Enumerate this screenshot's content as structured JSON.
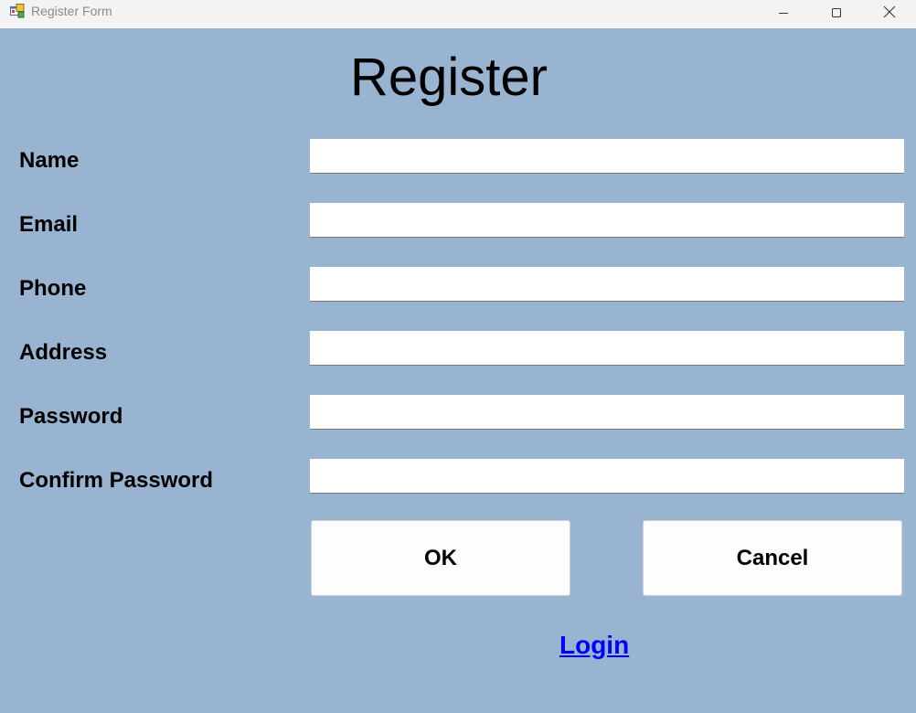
{
  "window": {
    "title": "Register Form",
    "icon": "winforms-app-icon",
    "controls": {
      "minimize_icon": "minimize-icon",
      "maximize_icon": "maximize-icon",
      "close_icon": "close-icon"
    }
  },
  "form": {
    "heading": "Register",
    "background_color": "#99b4d1",
    "fields": [
      {
        "label": "Name",
        "value": ""
      },
      {
        "label": "Email",
        "value": ""
      },
      {
        "label": "Phone",
        "value": ""
      },
      {
        "label": "Address",
        "value": ""
      },
      {
        "label": "Password",
        "value": ""
      },
      {
        "label": "Confirm Password",
        "value": ""
      }
    ],
    "buttons": {
      "ok_label": "OK",
      "cancel_label": "Cancel"
    },
    "login_link": "Login",
    "link_color": "#0000ff"
  }
}
